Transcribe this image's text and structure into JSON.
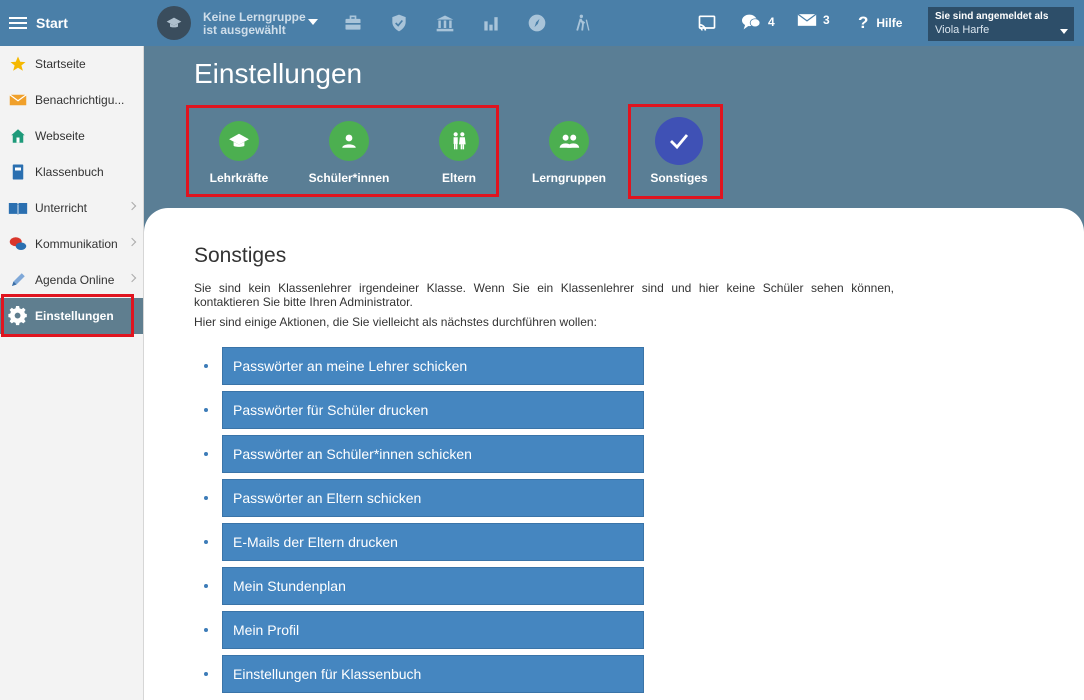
{
  "topbar": {
    "start_label": "Start",
    "group_line1": "Keine Lerngruppe",
    "group_line2": "ist ausgewählt",
    "icons": [
      "briefcase-icon",
      "shield-icon",
      "institution-icon",
      "chart-icon",
      "compass-icon",
      "hiking-icon"
    ],
    "chat_count": "4",
    "mail_count": "3",
    "help_label": "Hilfe",
    "login_label": "Sie sind angemeldet als",
    "user_name": "Viola Harfe"
  },
  "sidebar": {
    "items": [
      {
        "label": "Startseite",
        "icon": "star-icon"
      },
      {
        "label": "Benachrichtigu...",
        "icon": "envelope-icon"
      },
      {
        "label": "Webseite",
        "icon": "home-icon"
      },
      {
        "label": "Klassenbuch",
        "icon": "book-icon"
      },
      {
        "label": "Unterricht",
        "icon": "open-book-icon"
      },
      {
        "label": "Kommunikation",
        "icon": "chat-icon"
      },
      {
        "label": "Agenda Online",
        "icon": "pen-icon"
      },
      {
        "label": "Einstellungen",
        "icon": "gear-icon"
      }
    ]
  },
  "main": {
    "title": "Einstellungen",
    "tabs": [
      {
        "label": "Lehrkräfte",
        "icon": "graduation-cap-icon"
      },
      {
        "label": "Schüler*innen",
        "icon": "person-icon"
      },
      {
        "label": "Eltern",
        "icon": "parents-icon"
      },
      {
        "label": "Lerngruppen",
        "icon": "group-icon"
      },
      {
        "label": "Sonstiges",
        "icon": "check-icon"
      }
    ],
    "section_title": "Sonstiges",
    "info_text": "Sie sind kein Klassenlehrer irgendeiner Klasse. Wenn Sie ein Klassenlehrer sind und hier keine Schüler sehen können, kontaktieren Sie bitte Ihren Administrator.",
    "actions_intro": "Hier sind einige Aktionen, die Sie vielleicht als nächstes durchführen wollen:",
    "actions": [
      "Passwörter an meine Lehrer schicken",
      "Passwörter für Schüler drucken",
      "Passwörter an Schüler*innen schicken",
      "Passwörter an Eltern schicken",
      "E-Mails der Eltern drucken",
      "Mein Stundenplan",
      "Mein Profil",
      "Einstellungen für Klassenbuch"
    ]
  },
  "colors": {
    "topbar": "#4a7fa8",
    "header_bg": "#5a7e95",
    "tab_green": "#4caf50",
    "tab_selected": "#3f51b5",
    "action_button": "#4586c0",
    "highlight": "#e0141f"
  }
}
